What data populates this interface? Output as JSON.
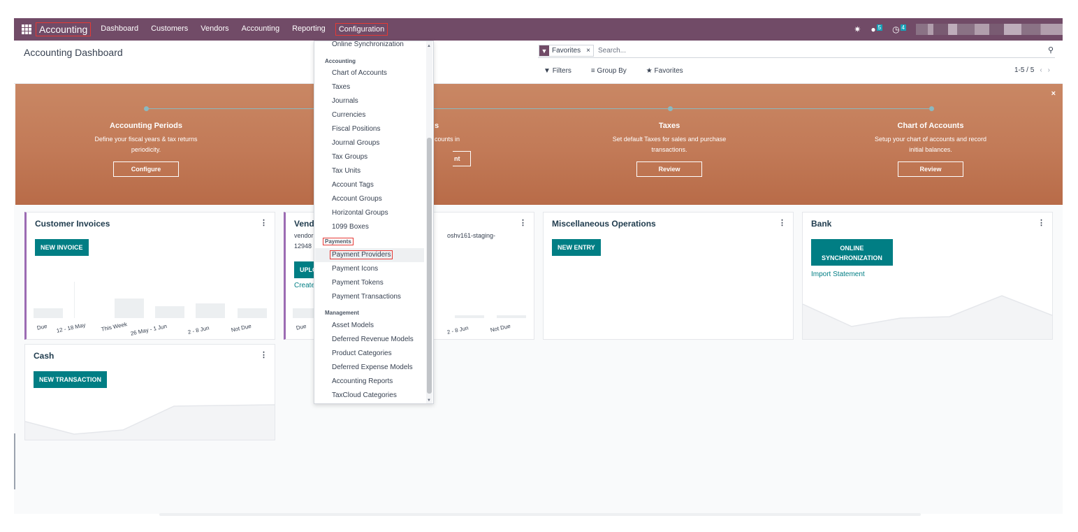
{
  "navbar": {
    "brand": "Accounting",
    "menu": [
      "Dashboard",
      "Customers",
      "Vendors",
      "Accounting",
      "Reporting",
      "Configuration"
    ],
    "active_menu": "Configuration",
    "icons": [
      "bug-icon",
      "chat-icon",
      "clock-icon"
    ],
    "badges": {
      "messages": "5",
      "activities": "4"
    }
  },
  "control_panel": {
    "title": "Accounting Dashboard",
    "search": {
      "facet": "Favorites",
      "facet_remove": "×",
      "placeholder": "Search..."
    },
    "filters": {
      "filters": "Filters",
      "group_by": "Group By",
      "favorites": "Favorites"
    },
    "pager": "1-5 / 5"
  },
  "banner": {
    "steps": [
      {
        "title": "Accounting Periods",
        "desc1": "Define your fiscal years & tax returns",
        "desc2": "periodicity.",
        "button": "Configure"
      },
      {
        "title": "s",
        "desc1": "counts in",
        "desc2": "",
        "button": "nt"
      },
      {
        "title": "Taxes",
        "desc1": "Set default Taxes for sales and purchase",
        "desc2": "transactions.",
        "button": "Review"
      },
      {
        "title": "Chart of Accounts",
        "desc1": "Setup your chart of accounts and record",
        "desc2": "initial balances.",
        "button": "Review"
      }
    ],
    "close": "×"
  },
  "cards": {
    "customer_invoices": {
      "title": "Customer Invoices",
      "button": "NEW INVOICE",
      "labels": [
        "Due",
        "12 - 18 May",
        "This Week",
        "26 May - 1 Jun",
        "2 - 8 Jun",
        "Not Due"
      ]
    },
    "vendor": {
      "title": "Vend",
      "line1": "vendor",
      "line1b": "oshv161-staging-",
      "line2": "12948",
      "button": "UPLO",
      "link": "Create",
      "labels": [
        "Due",
        "2 - 8 Jun",
        "Not Due"
      ]
    },
    "misc": {
      "title": "Miscellaneous Operations",
      "button": "NEW ENTRY"
    },
    "bank": {
      "title": "Bank",
      "button_line1": "ONLINE",
      "button_line2": "SYNCHRONIZATION",
      "link": "Import Statement"
    },
    "cash": {
      "title": "Cash",
      "button": "NEW TRANSACTION"
    },
    "menu_glyph": "⋮"
  },
  "dropdown": {
    "top_item": "Online Synchronization",
    "accounting_header": "Accounting",
    "accounting_items": [
      "Chart of Accounts",
      "Taxes",
      "Journals",
      "Currencies",
      "Fiscal Positions",
      "Journal Groups",
      "Tax Groups",
      "Tax Units",
      "Account Tags",
      "Account Groups",
      "Horizontal Groups",
      "1099 Boxes"
    ],
    "payments_header": "Payments",
    "payments_items": [
      "Payment Providers",
      "Payment Icons",
      "Payment Tokens",
      "Payment Transactions"
    ],
    "management_header": "Management",
    "management_items": [
      "Asset Models",
      "Deferred Revenue Models",
      "Product Categories",
      "Deferred Expense Models",
      "Accounting Reports",
      "TaxCloud Categories"
    ]
  },
  "colors": {
    "navbar": "#714b67",
    "primary": "#017e84",
    "highlight": "#e53935"
  }
}
